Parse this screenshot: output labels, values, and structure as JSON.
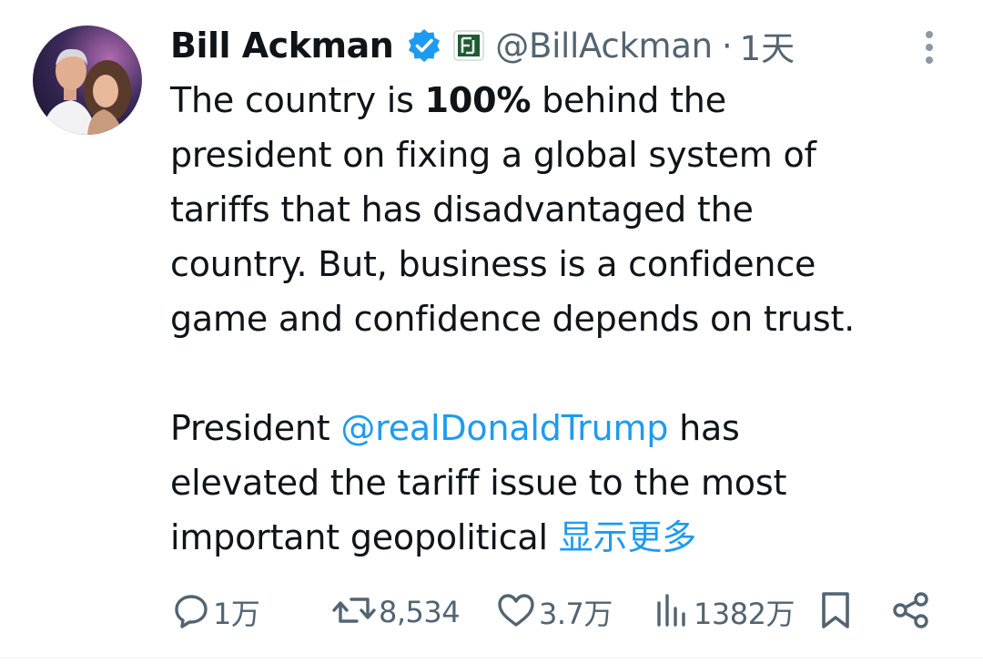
{
  "tweet": {
    "author": {
      "display_name": "Bill Ackman",
      "handle": "@BillAckman",
      "separator": "·",
      "time": "1天"
    },
    "text": {
      "p1_l1_a": "The country is ",
      "p1_l1_bold": "100%",
      "p1_l1_b": " behind the",
      "p1_l2": "president on fixing a global system of",
      "p1_l3": "tariffs that has disadvantaged the",
      "p1_l4": "country. But, business is a confidence",
      "p1_l5": "game and confidence depends on trust.",
      "p2_l1_a": "President ",
      "p2_l1_mention": "@realDonaldTrump",
      "p2_l1_b": " has",
      "p2_l2": "elevated the tariff issue to the most",
      "p2_l3": "important geopolitical ",
      "show_more": "显示更多"
    },
    "actions": {
      "replies": "1万",
      "reposts": "8,534",
      "likes": "3.7万",
      "views": "1382万"
    },
    "icons": {
      "verified": "verified-badge-icon",
      "affiliation": "affiliation-badge-icon",
      "more": "more-vertical-icon",
      "reply": "reply-icon",
      "repost": "repost-icon",
      "like": "heart-icon",
      "views": "views-bar-chart-icon",
      "bookmark": "bookmark-icon",
      "share": "share-icon"
    },
    "colors": {
      "accent": "#1d9bf0",
      "secondary_text": "#536471",
      "primary_text": "#0f1419"
    }
  }
}
